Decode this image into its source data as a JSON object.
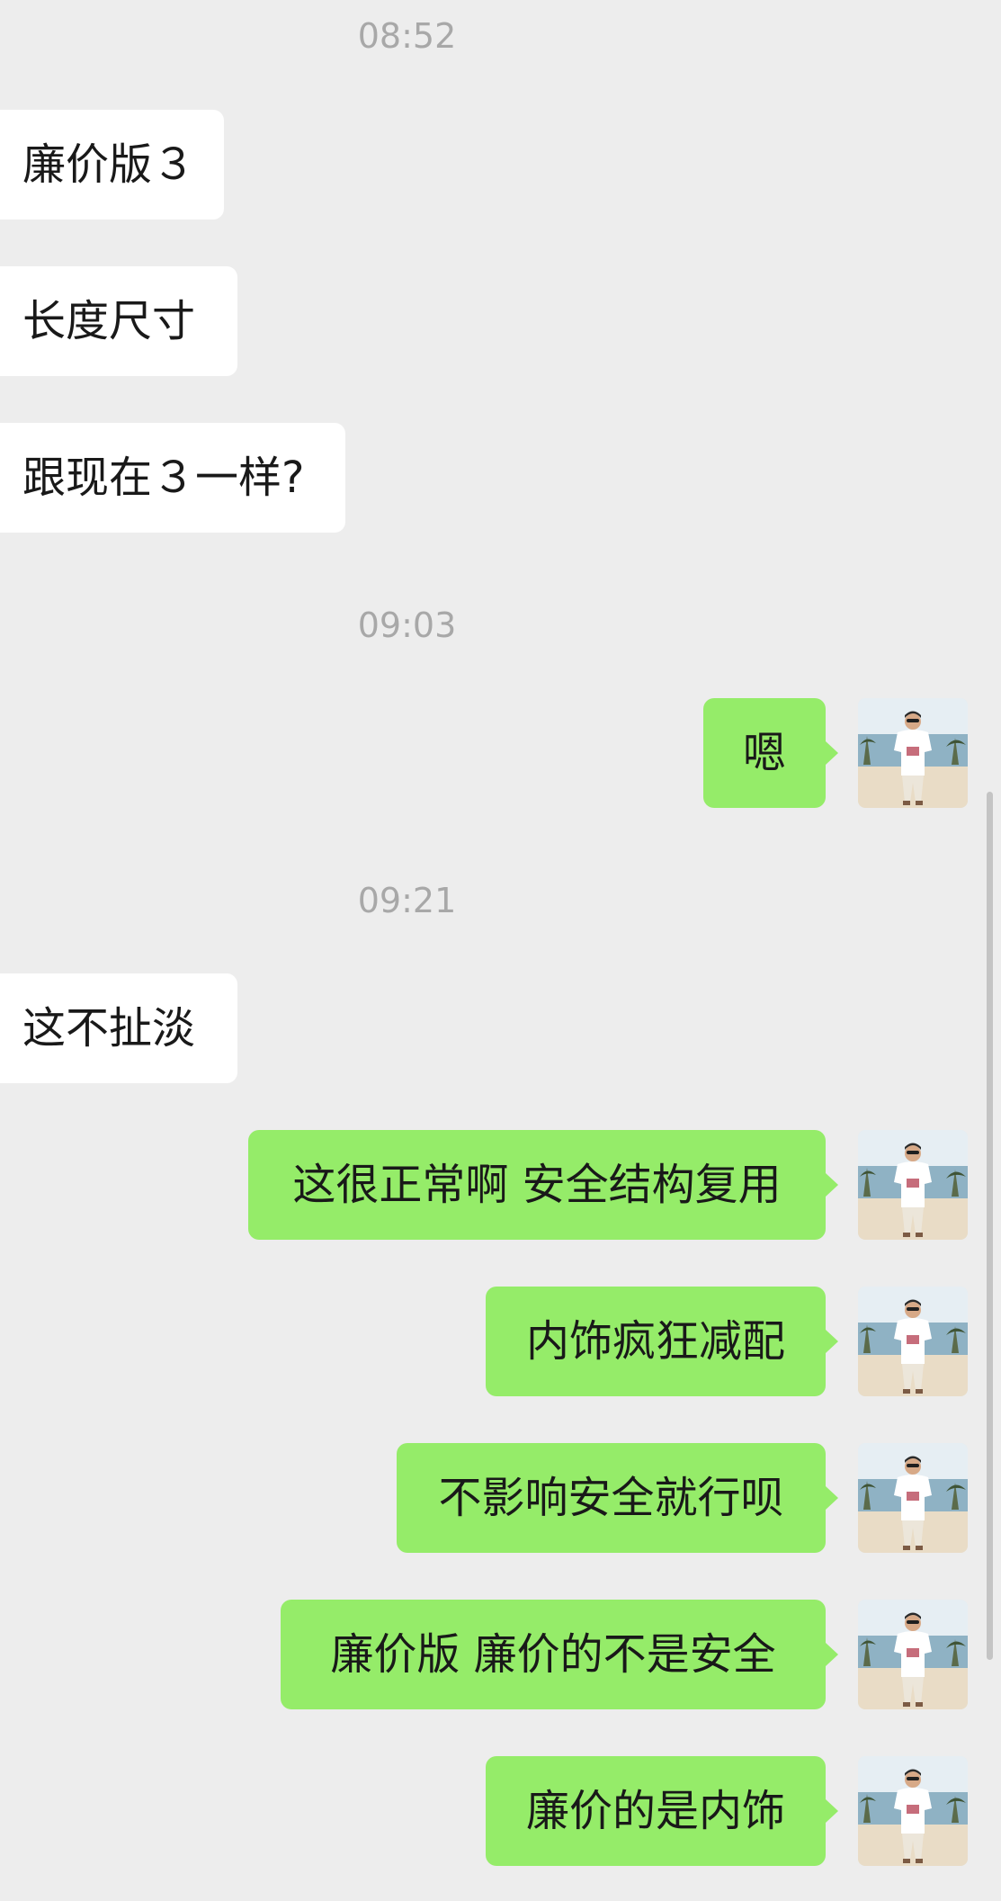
{
  "timestamps": [
    "08:52",
    "09:03",
    "09:21"
  ],
  "messages": [
    {
      "side": "left",
      "text": "廉价版３"
    },
    {
      "side": "left",
      "text": "长度尺寸"
    },
    {
      "side": "left",
      "text": "跟现在３一样?"
    },
    {
      "side": "right",
      "text": "嗯"
    },
    {
      "side": "left",
      "text": "这不扯淡"
    },
    {
      "side": "right",
      "text": "这很正常啊 安全结构复用"
    },
    {
      "side": "right",
      "text": "内饰疯狂减配"
    },
    {
      "side": "right",
      "text": "不影响安全就行呗"
    },
    {
      "side": "right",
      "text": "廉价版 廉价的不是安全"
    },
    {
      "side": "right",
      "text": "廉价的是内饰"
    }
  ],
  "colors": {
    "background": "#ededed",
    "incoming_bubble": "#ffffff",
    "outgoing_bubble": "#95ec69",
    "timestamp_text": "#a8a8a8"
  },
  "avatar_icon": "user-photo-avatar"
}
